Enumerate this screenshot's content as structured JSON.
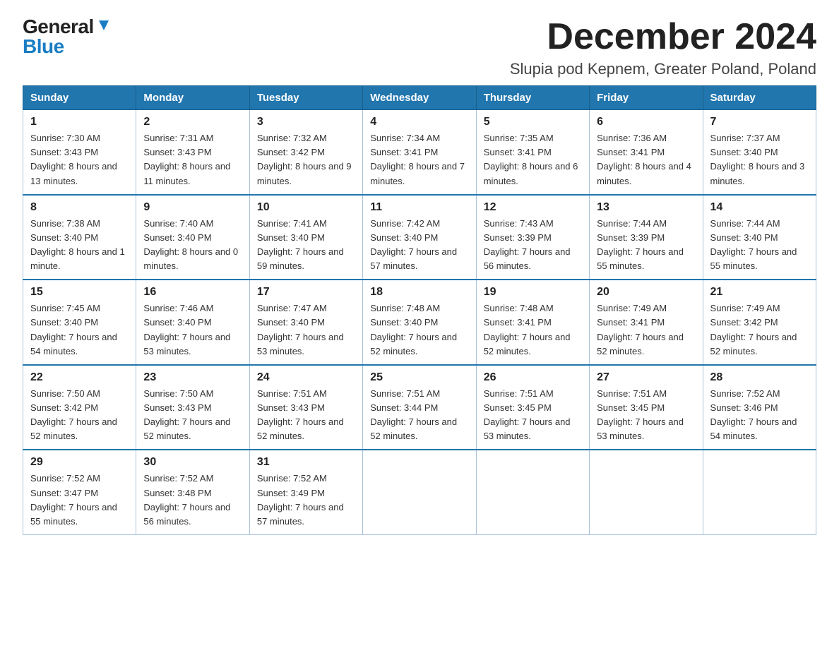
{
  "logo": {
    "general": "General",
    "blue": "Blue",
    "triangle": "▶"
  },
  "title": "December 2024",
  "subtitle": "Slupia pod Kepnem, Greater Poland, Poland",
  "weekdays": [
    "Sunday",
    "Monday",
    "Tuesday",
    "Wednesday",
    "Thursday",
    "Friday",
    "Saturday"
  ],
  "weeks": [
    [
      {
        "day": "1",
        "sunrise": "Sunrise: 7:30 AM",
        "sunset": "Sunset: 3:43 PM",
        "daylight": "Daylight: 8 hours and 13 minutes."
      },
      {
        "day": "2",
        "sunrise": "Sunrise: 7:31 AM",
        "sunset": "Sunset: 3:43 PM",
        "daylight": "Daylight: 8 hours and 11 minutes."
      },
      {
        "day": "3",
        "sunrise": "Sunrise: 7:32 AM",
        "sunset": "Sunset: 3:42 PM",
        "daylight": "Daylight: 8 hours and 9 minutes."
      },
      {
        "day": "4",
        "sunrise": "Sunrise: 7:34 AM",
        "sunset": "Sunset: 3:41 PM",
        "daylight": "Daylight: 8 hours and 7 minutes."
      },
      {
        "day": "5",
        "sunrise": "Sunrise: 7:35 AM",
        "sunset": "Sunset: 3:41 PM",
        "daylight": "Daylight: 8 hours and 6 minutes."
      },
      {
        "day": "6",
        "sunrise": "Sunrise: 7:36 AM",
        "sunset": "Sunset: 3:41 PM",
        "daylight": "Daylight: 8 hours and 4 minutes."
      },
      {
        "day": "7",
        "sunrise": "Sunrise: 7:37 AM",
        "sunset": "Sunset: 3:40 PM",
        "daylight": "Daylight: 8 hours and 3 minutes."
      }
    ],
    [
      {
        "day": "8",
        "sunrise": "Sunrise: 7:38 AM",
        "sunset": "Sunset: 3:40 PM",
        "daylight": "Daylight: 8 hours and 1 minute."
      },
      {
        "day": "9",
        "sunrise": "Sunrise: 7:40 AM",
        "sunset": "Sunset: 3:40 PM",
        "daylight": "Daylight: 8 hours and 0 minutes."
      },
      {
        "day": "10",
        "sunrise": "Sunrise: 7:41 AM",
        "sunset": "Sunset: 3:40 PM",
        "daylight": "Daylight: 7 hours and 59 minutes."
      },
      {
        "day": "11",
        "sunrise": "Sunrise: 7:42 AM",
        "sunset": "Sunset: 3:40 PM",
        "daylight": "Daylight: 7 hours and 57 minutes."
      },
      {
        "day": "12",
        "sunrise": "Sunrise: 7:43 AM",
        "sunset": "Sunset: 3:39 PM",
        "daylight": "Daylight: 7 hours and 56 minutes."
      },
      {
        "day": "13",
        "sunrise": "Sunrise: 7:44 AM",
        "sunset": "Sunset: 3:39 PM",
        "daylight": "Daylight: 7 hours and 55 minutes."
      },
      {
        "day": "14",
        "sunrise": "Sunrise: 7:44 AM",
        "sunset": "Sunset: 3:40 PM",
        "daylight": "Daylight: 7 hours and 55 minutes."
      }
    ],
    [
      {
        "day": "15",
        "sunrise": "Sunrise: 7:45 AM",
        "sunset": "Sunset: 3:40 PM",
        "daylight": "Daylight: 7 hours and 54 minutes."
      },
      {
        "day": "16",
        "sunrise": "Sunrise: 7:46 AM",
        "sunset": "Sunset: 3:40 PM",
        "daylight": "Daylight: 7 hours and 53 minutes."
      },
      {
        "day": "17",
        "sunrise": "Sunrise: 7:47 AM",
        "sunset": "Sunset: 3:40 PM",
        "daylight": "Daylight: 7 hours and 53 minutes."
      },
      {
        "day": "18",
        "sunrise": "Sunrise: 7:48 AM",
        "sunset": "Sunset: 3:40 PM",
        "daylight": "Daylight: 7 hours and 52 minutes."
      },
      {
        "day": "19",
        "sunrise": "Sunrise: 7:48 AM",
        "sunset": "Sunset: 3:41 PM",
        "daylight": "Daylight: 7 hours and 52 minutes."
      },
      {
        "day": "20",
        "sunrise": "Sunrise: 7:49 AM",
        "sunset": "Sunset: 3:41 PM",
        "daylight": "Daylight: 7 hours and 52 minutes."
      },
      {
        "day": "21",
        "sunrise": "Sunrise: 7:49 AM",
        "sunset": "Sunset: 3:42 PM",
        "daylight": "Daylight: 7 hours and 52 minutes."
      }
    ],
    [
      {
        "day": "22",
        "sunrise": "Sunrise: 7:50 AM",
        "sunset": "Sunset: 3:42 PM",
        "daylight": "Daylight: 7 hours and 52 minutes."
      },
      {
        "day": "23",
        "sunrise": "Sunrise: 7:50 AM",
        "sunset": "Sunset: 3:43 PM",
        "daylight": "Daylight: 7 hours and 52 minutes."
      },
      {
        "day": "24",
        "sunrise": "Sunrise: 7:51 AM",
        "sunset": "Sunset: 3:43 PM",
        "daylight": "Daylight: 7 hours and 52 minutes."
      },
      {
        "day": "25",
        "sunrise": "Sunrise: 7:51 AM",
        "sunset": "Sunset: 3:44 PM",
        "daylight": "Daylight: 7 hours and 52 minutes."
      },
      {
        "day": "26",
        "sunrise": "Sunrise: 7:51 AM",
        "sunset": "Sunset: 3:45 PM",
        "daylight": "Daylight: 7 hours and 53 minutes."
      },
      {
        "day": "27",
        "sunrise": "Sunrise: 7:51 AM",
        "sunset": "Sunset: 3:45 PM",
        "daylight": "Daylight: 7 hours and 53 minutes."
      },
      {
        "day": "28",
        "sunrise": "Sunrise: 7:52 AM",
        "sunset": "Sunset: 3:46 PM",
        "daylight": "Daylight: 7 hours and 54 minutes."
      }
    ],
    [
      {
        "day": "29",
        "sunrise": "Sunrise: 7:52 AM",
        "sunset": "Sunset: 3:47 PM",
        "daylight": "Daylight: 7 hours and 55 minutes."
      },
      {
        "day": "30",
        "sunrise": "Sunrise: 7:52 AM",
        "sunset": "Sunset: 3:48 PM",
        "daylight": "Daylight: 7 hours and 56 minutes."
      },
      {
        "day": "31",
        "sunrise": "Sunrise: 7:52 AM",
        "sunset": "Sunset: 3:49 PM",
        "daylight": "Daylight: 7 hours and 57 minutes."
      },
      null,
      null,
      null,
      null
    ]
  ]
}
